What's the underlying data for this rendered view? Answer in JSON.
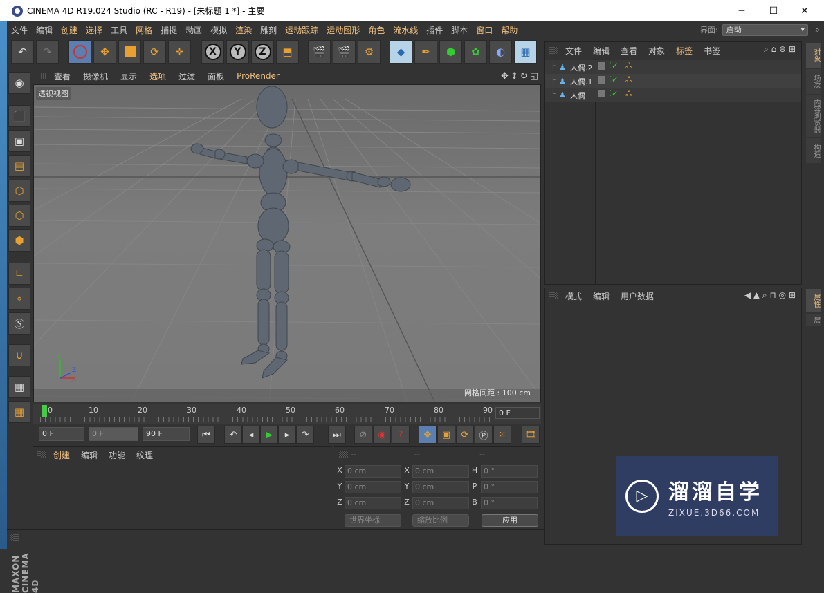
{
  "window": {
    "title": "CINEMA 4D R19.024 Studio (RC - R19) - [未标题 1 *] - 主要",
    "minimize": "─",
    "maximize": "☐",
    "close": "✕"
  },
  "menubar": {
    "items": [
      "文件",
      "编辑",
      "创建",
      "选择",
      "工具",
      "网格",
      "捕捉",
      "动画",
      "模拟",
      "渲染",
      "雕刻",
      "运动跟踪",
      "运动图形",
      "角色",
      "流水线",
      "插件",
      "脚本",
      "窗口",
      "帮助"
    ],
    "layout_label": "界面:",
    "layout_value": "启动"
  },
  "viewport": {
    "menu": [
      "查看",
      "摄像机",
      "显示",
      "选项",
      "过滤",
      "面板",
      "ProRender"
    ],
    "label": "透视视图",
    "grid_info": "网格间距 : 100 cm",
    "axis_y": "Y",
    "axis_z": "Z",
    "axis_x": "X"
  },
  "timeline": {
    "ticks": [
      "0",
      "10",
      "20",
      "30",
      "40",
      "50",
      "60",
      "70",
      "80",
      "90"
    ],
    "current_frame": "0 F"
  },
  "transport": {
    "start": "0 F",
    "preview_start": "0 F",
    "end": "90 F"
  },
  "material_panel": {
    "menu": [
      "创建",
      "编辑",
      "功能",
      "纹理"
    ]
  },
  "coord_panel": {
    "headers": [
      "--",
      "--",
      "--"
    ],
    "rows": [
      {
        "l1": "X",
        "v1": "0 cm",
        "l2": "X",
        "v2": "0 cm",
        "l3": "H",
        "v3": "0 °"
      },
      {
        "l1": "Y",
        "v1": "0 cm",
        "l2": "Y",
        "v2": "0 cm",
        "l3": "P",
        "v3": "0 °"
      },
      {
        "l1": "Z",
        "v1": "0 cm",
        "l2": "Z",
        "v2": "0 cm",
        "l3": "B",
        "v3": "0 °"
      }
    ],
    "world_coords": "世界坐标",
    "scale": "缩放比例",
    "apply": "应用"
  },
  "object_manager": {
    "menu": [
      "文件",
      "编辑",
      "查看",
      "对象",
      "标签",
      "书签"
    ],
    "objects": [
      "人偶.2",
      "人偶.1",
      "人偶"
    ]
  },
  "attributes": {
    "menu": [
      "模式",
      "编辑",
      "用户数据"
    ]
  },
  "side_tabs": {
    "top": [
      "对象",
      "场次",
      "内容浏览器",
      "构造"
    ],
    "bottom": [
      "属性",
      "层"
    ]
  },
  "watermark": {
    "cn": "溜溜自学",
    "en": "ZIXUE.3D66.COM"
  },
  "brand": {
    "vertical": "MAXON CINEMA 4D"
  },
  "colors": {
    "accent": "#f0c080",
    "active_tool": "#5a7fb0",
    "panel_bg": "#333333",
    "viewport_bg": "#737373"
  }
}
